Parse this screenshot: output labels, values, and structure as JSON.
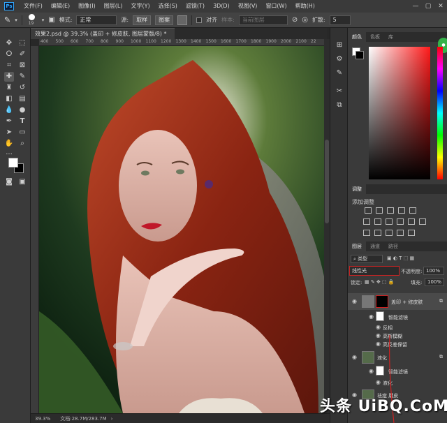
{
  "app": {
    "logo_text": "Ps"
  },
  "menu": [
    "文件(F)",
    "编辑(E)",
    "图像(I)",
    "图层(L)",
    "文字(Y)",
    "选择(S)",
    "滤镜(T)",
    "3D(D)",
    "视图(V)",
    "窗口(W)",
    "帮助(H)"
  ],
  "options": {
    "brush_size": "19",
    "mode_label": "模式:",
    "mode_value": "正常",
    "source_label": "源:",
    "sample_btn": "取样",
    "pattern_btn": "图案",
    "aligned_label": "对齐",
    "sample_label": "样本:",
    "sample_value": "当前图层",
    "spread_label": "扩散:",
    "spread_value": "5"
  },
  "document": {
    "tab_title": "效果2.psd @ 39.3% (盖印 + 修皮肤, 图层蒙版/8) *",
    "zoom": "39.3%",
    "doc_info": "文档:28.7M/283.7M"
  },
  "ruler": {
    "top_ticks": [
      "400",
      "500",
      "600",
      "700",
      "800",
      "900",
      "1000",
      "1100",
      "1200",
      "1300",
      "1400",
      "1500",
      "1600",
      "1700",
      "1800",
      "1900",
      "2000",
      "2100",
      "22"
    ]
  },
  "panels": {
    "color_tabs": [
      "颜色",
      "色板",
      "库"
    ],
    "adjust_tabs": [
      "调整"
    ],
    "adjust_title": "添加调整",
    "layers_tabs": [
      "图层",
      "通道",
      "路径"
    ],
    "filter_kind": "类型",
    "blend_mode": "线性光",
    "opacity_label": "不透明度:",
    "opacity_value": "100%",
    "lock_label": "锁定:",
    "fill_label": "填充:",
    "fill_value": "100%"
  },
  "layers": [
    {
      "name": "盖印 + 修皮肤"
    },
    {
      "name": "智能滤镜"
    },
    {
      "name": "反相"
    },
    {
      "name": "高斯模糊"
    },
    {
      "name": "高反差保留"
    },
    {
      "name": "液化"
    },
    {
      "name": "智能滤镜"
    },
    {
      "name": "液化"
    },
    {
      "name": "祛痘 磨皮"
    }
  ],
  "watermark": {
    "text": "头条 UiBQ.CoM"
  },
  "colors": {
    "accent_red": "#cc2222",
    "badge_green": "#35b24a"
  }
}
